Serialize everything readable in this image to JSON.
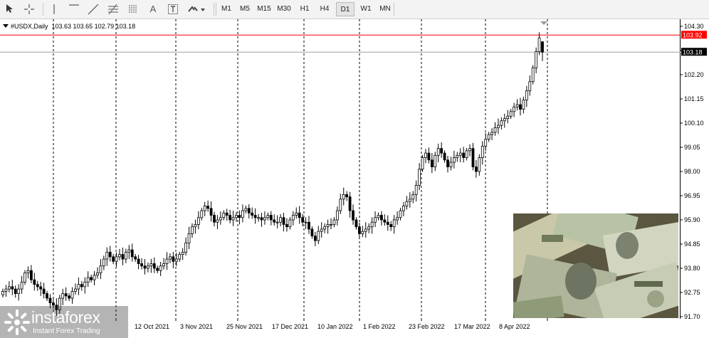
{
  "toolbar": {
    "icons": [
      "cursor-icon",
      "crosshair-icon",
      "vertical-line-icon",
      "horizontal-line-icon",
      "trend-line-icon",
      "fibonacci-icon",
      "fibonacci-fan-icon",
      "text-icon",
      "text-label-icon",
      "shapes-icon"
    ],
    "text_tool_label": "A",
    "timeframes": [
      "M1",
      "M5",
      "M15",
      "M30",
      "H1",
      "H4",
      "D1",
      "W1",
      "MN"
    ],
    "active_timeframe": "D1"
  },
  "symbol": {
    "name": "#USDX,Daily",
    "ohlc": "103.63 103.65 102.79 103.18"
  },
  "chart_data": {
    "type": "candlestick",
    "symbol": "#USDX",
    "period": "Daily",
    "price_axis_ticks": [
      "104.30",
      "103.25",
      "102.20",
      "101.15",
      "100.10",
      "99.05",
      "98.00",
      "96.95",
      "95.90",
      "94.85",
      "93.80",
      "92.75",
      "91.70"
    ],
    "price_axis_range": [
      91.7,
      104.3
    ],
    "date_axis_ticks": [
      "12 Oct 2021",
      "3 Nov 2021",
      "25 Nov 2021",
      "17 Dec 2021",
      "10 Jan 2022",
      "1 Feb 2022",
      "23 Feb 2022",
      "17 Mar 2022",
      "8 Apr 2022"
    ],
    "high_line": {
      "value": 103.92,
      "label": "103.92",
      "color": "#ff0000"
    },
    "current_price": {
      "value": 103.18,
      "label": "103.18",
      "color": "#000000"
    },
    "last_bar": {
      "open": 103.63,
      "high": 103.65,
      "low": 102.79,
      "close": 103.18
    },
    "candles_close": [
      92.8,
      92.9,
      93.0,
      92.9,
      92.7,
      92.9,
      93.2,
      93.6,
      93.7,
      93.3,
      93.1,
      93.0,
      92.9,
      92.7,
      92.5,
      92.3,
      92.2,
      92.0,
      92.5,
      92.7,
      92.6,
      92.5,
      92.8,
      92.9,
      93.1,
      93.0,
      93.2,
      93.4,
      93.3,
      93.5,
      93.6,
      93.9,
      94.2,
      94.5,
      94.3,
      94.1,
      94.3,
      94.4,
      94.2,
      94.5,
      94.6,
      94.3,
      94.2,
      94.0,
      93.9,
      93.8,
      93.9,
      94.0,
      93.8,
      93.7,
      93.9,
      94.0,
      94.2,
      94.3,
      94.1,
      94.2,
      94.4,
      94.5,
      94.9,
      95.3,
      95.6,
      95.7,
      96.0,
      96.3,
      96.5,
      96.4,
      96.1,
      95.8,
      95.9,
      96.0,
      96.2,
      96.1,
      95.9,
      96.0,
      96.1,
      96.0,
      96.3,
      96.4,
      96.2,
      96.1,
      96.0,
      96.0,
      95.9,
      96.0,
      96.1,
      95.9,
      95.8,
      95.8,
      96.0,
      95.7,
      95.6,
      95.9,
      96.1,
      96.2,
      96.0,
      95.8,
      95.8,
      95.5,
      95.2,
      95.0,
      95.4,
      95.5,
      95.6,
      95.7,
      95.7,
      95.9,
      96.3,
      96.8,
      97.0,
      96.9,
      96.3,
      95.9,
      95.6,
      95.3,
      95.4,
      95.5,
      95.6,
      95.8,
      96.0,
      96.1,
      95.9,
      95.8,
      95.7,
      95.6,
      95.9,
      96.0,
      96.3,
      96.5,
      96.7,
      96.8,
      97.0,
      97.4,
      98.1,
      98.6,
      98.8,
      98.5,
      98.2,
      98.7,
      99.0,
      98.8,
      98.5,
      98.2,
      98.4,
      98.6,
      98.7,
      98.8,
      98.6,
      98.9,
      99.0,
      98.2,
      98.0,
      98.6,
      99.1,
      99.4,
      99.6,
      99.7,
      99.9,
      100.0,
      100.2,
      100.3,
      100.4,
      100.6,
      100.8,
      100.9,
      100.7,
      101.1,
      101.5,
      101.9,
      102.5,
      103.2,
      103.8,
      103.18
    ]
  },
  "branding": {
    "name": "instaforex",
    "tagline": "Instant Forex Trading"
  }
}
